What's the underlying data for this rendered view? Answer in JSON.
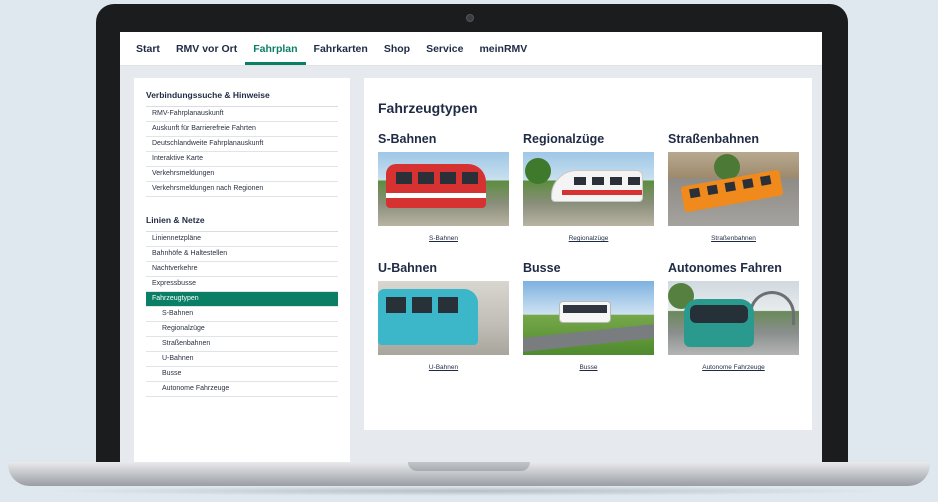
{
  "nav": {
    "items": [
      {
        "label": "Start",
        "active": false
      },
      {
        "label": "RMV vor Ort",
        "active": false
      },
      {
        "label": "Fahrplan",
        "active": true
      },
      {
        "label": "Fahrkarten",
        "active": false
      },
      {
        "label": "Shop",
        "active": false
      },
      {
        "label": "Service",
        "active": false
      },
      {
        "label": "meinRMV",
        "active": false
      }
    ]
  },
  "sidebar": {
    "section1": {
      "heading": "Verbindungssuche & Hinweise",
      "links": [
        "RMV-Fahrplanauskunft",
        "Auskunft für Barrierefreie Fahrten",
        "Deutschlandweite Fahrplanauskunft",
        "Interaktive Karte",
        "Verkehrsmeldungen",
        "Verkehrsmeldungen nach Regionen"
      ]
    },
    "section2": {
      "heading": "Linien & Netze",
      "links": [
        "Liniennetzpläne",
        "Bahnhöfe & Haltestellen",
        "Nachtverkehre",
        "Expressbusse",
        "Fahrzeugtypen"
      ],
      "active": "Fahrzeugtypen",
      "sublinks": [
        "S-Bahnen",
        "Regionalzüge",
        "Straßenbahnen",
        "U-Bahnen",
        "Busse",
        "Autonome Fahrzeuge"
      ]
    }
  },
  "main": {
    "title": "Fahrzeugtypen",
    "cards": [
      {
        "title": "S-Bahnen",
        "link": "S-Bahnen",
        "image": "s-bahn-photo"
      },
      {
        "title": "Regionalzüge",
        "link": "Regionalzüge",
        "image": "regional-train-photo"
      },
      {
        "title": "Straßenbahnen",
        "link": "Straßenbahnen",
        "image": "tram-photo"
      },
      {
        "title": "U-Bahnen",
        "link": "U-Bahnen",
        "image": "u-bahn-photo"
      },
      {
        "title": "Busse",
        "link": "Busse",
        "image": "bus-photo"
      },
      {
        "title": "Autonomes Fahren",
        "link": "Autonome Fahrzeuge",
        "image": "autonomous-shuttle-photo"
      }
    ]
  },
  "colors": {
    "accent": "#0b7f66",
    "text": "#1f2a44",
    "background": "#dfe8ef"
  }
}
